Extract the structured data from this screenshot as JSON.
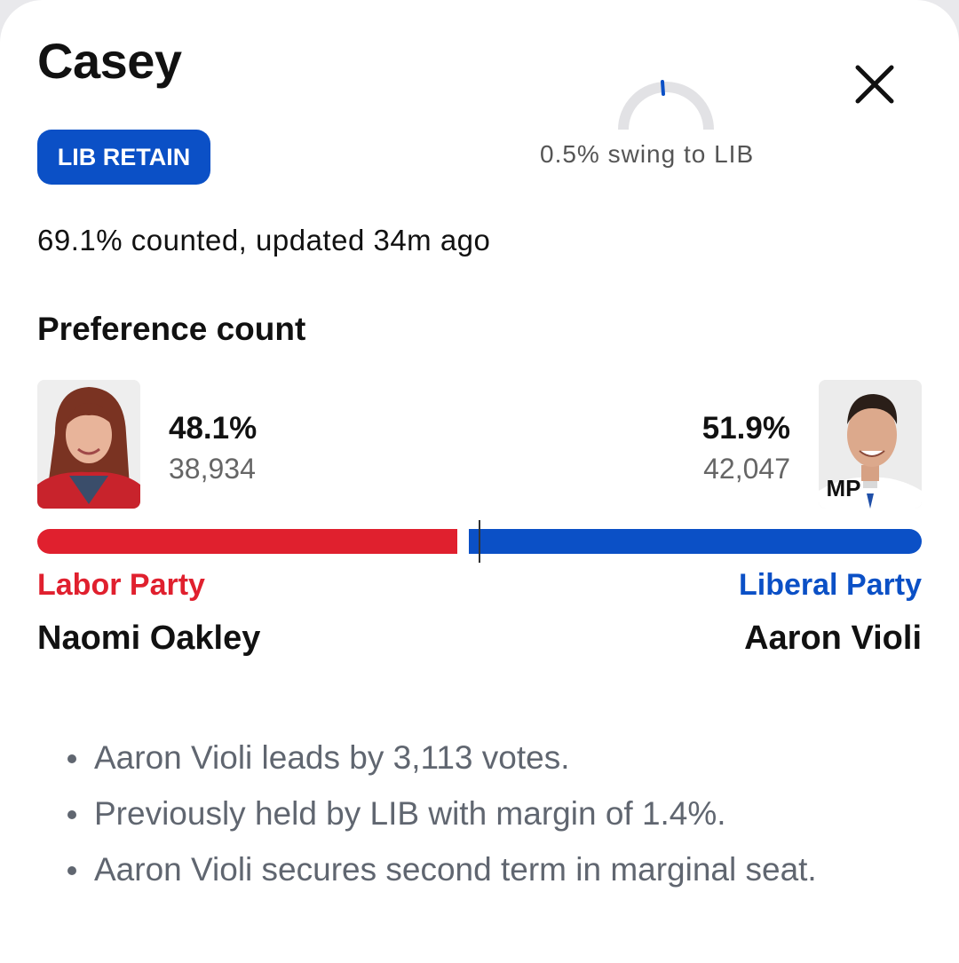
{
  "seat": {
    "title": "Casey",
    "status_badge": "LIB RETAIN",
    "swing_text": "0.5% swing to LIB",
    "swing_value_pct": 0.5,
    "counted_text": "69.1% counted, updated 34m ago"
  },
  "preference": {
    "heading": "Preference count",
    "left": {
      "percent": "48.1%",
      "votes": "38,934",
      "party": "Labor Party",
      "candidate": "Naomi Oakley",
      "share": 48.1
    },
    "right": {
      "percent": "51.9%",
      "votes": "42,047",
      "party": "Liberal Party",
      "candidate": "Aaron Violi",
      "badge": "MP",
      "share": 51.9
    }
  },
  "notes": [
    "Aaron Violi leads by 3,113 votes.",
    "Previously held by LIB with margin of 1.4%.",
    "Aaron Violi secures second term in marginal seat."
  ],
  "colors": {
    "labor": "#e0202e",
    "liberal": "#0b50c6",
    "muted": "#606670"
  },
  "icons": {
    "close": "close-icon",
    "left_photo": "candidate-photo-naomi-oakley",
    "right_photo": "candidate-photo-aaron-violi"
  }
}
